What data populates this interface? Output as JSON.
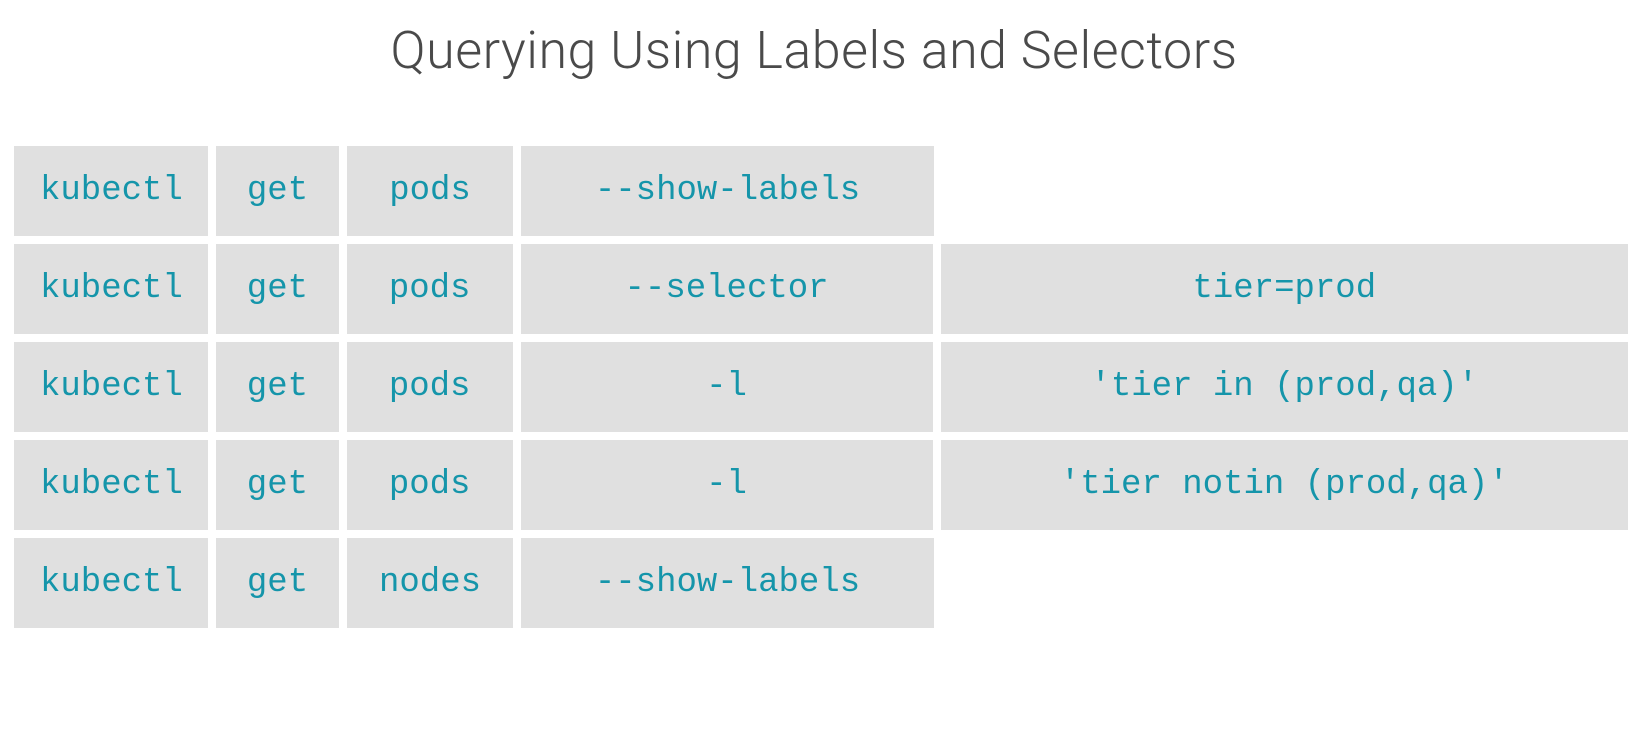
{
  "title": "Querying Using Labels and Selectors",
  "rows": [
    {
      "c0": "kubectl",
      "c1": "get",
      "c2": "pods",
      "c3": "--show-labels",
      "c4": null
    },
    {
      "c0": "kubectl",
      "c1": "get",
      "c2": "pods",
      "c3": "--selector",
      "c4": "tier=prod"
    },
    {
      "c0": "kubectl",
      "c1": "get",
      "c2": "pods",
      "c3": "-l",
      "c4": "'tier in (prod,qa)'"
    },
    {
      "c0": "kubectl",
      "c1": "get",
      "c2": "pods",
      "c3": "-l",
      "c4": "'tier notin (prod,qa)'"
    },
    {
      "c0": "kubectl",
      "c1": "get",
      "c2": "nodes",
      "c3": "--show-labels",
      "c4": null
    }
  ]
}
